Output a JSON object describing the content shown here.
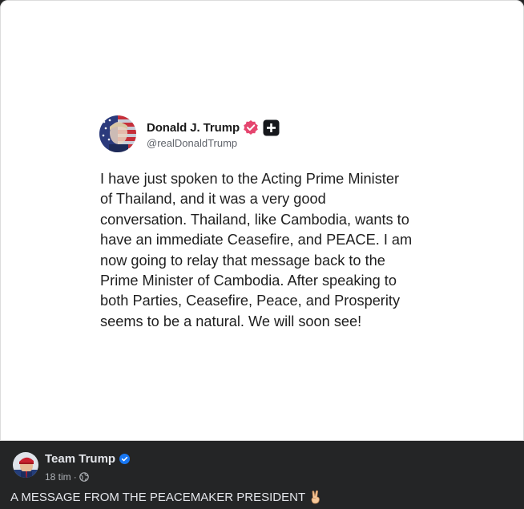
{
  "truth_post": {
    "author_name": "Donald J. Trump",
    "author_handle": "@realDonaldTrump",
    "body": "I have just spoken to the Acting Prime Minister\nof Thailand, and it was a very good\nconversation. Thailand, like Cambodia, wants to\nhave an immediate Ceasefire, and PEACE. I am\nnow going to relay that message back to the\nPrime Minister of Cambodia. After speaking to\nboth Parties, Ceasefire, Peace, and Prosperity\nseems to be a natural. We will soon see!",
    "verified_color": "#e5466f"
  },
  "facebook_post": {
    "page_name": "Team Trump",
    "timestamp": "18 tim",
    "separator": "·",
    "audience_icon": "globe-icon",
    "caption": "A MESSAGE FROM THE PEACEMAKER PRESIDENT",
    "caption_emoji_icon": "peace-hand-icon",
    "verified_color": "#1877f2"
  }
}
